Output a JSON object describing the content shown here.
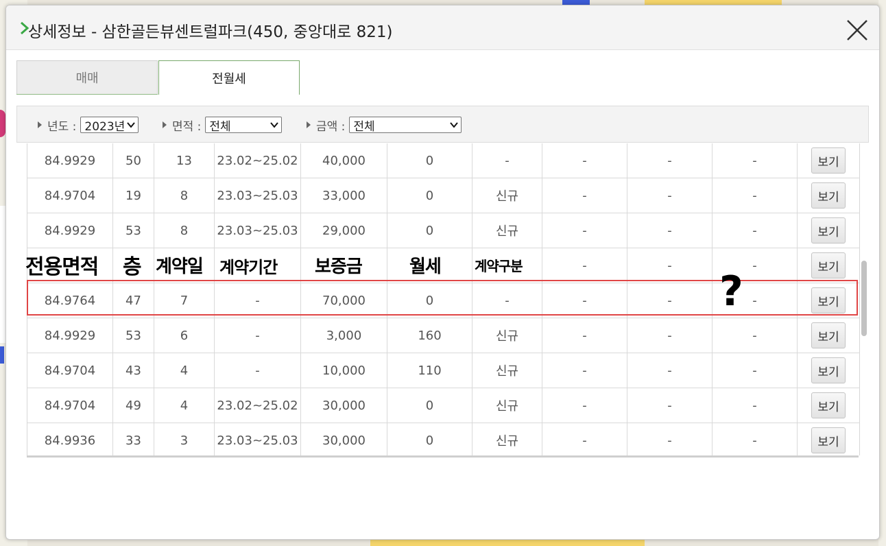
{
  "dialog": {
    "title": "상세정보 - 삼한골든뷰센트럴파크(450, 중앙대로 821)"
  },
  "tabs": [
    {
      "label": "매매",
      "active": false
    },
    {
      "label": "전월세",
      "active": true
    }
  ],
  "filters": {
    "year": {
      "label": "년도 :",
      "value": "2023년"
    },
    "area": {
      "label": "면적 :",
      "value": "전체"
    },
    "price": {
      "label": "금액 :",
      "value": "전체"
    }
  },
  "overlay_headers": [
    "전용면적",
    "층",
    "계약일",
    "계약기간",
    "보증금",
    "월세",
    "계약구분"
  ],
  "overlay_question": "?",
  "view_label": "보기",
  "rows": [
    {
      "area": "84.9929",
      "floor": "50",
      "day": "13",
      "period": "23.02~25.02",
      "deposit": "40,000",
      "rent": "0",
      "type": "-",
      "c1": "-",
      "c2": "-",
      "c3": "-"
    },
    {
      "area": "84.9704",
      "floor": "19",
      "day": "8",
      "period": "23.03~25.03",
      "deposit": "33,000",
      "rent": "0",
      "type": "신규",
      "c1": "-",
      "c2": "-",
      "c3": "-"
    },
    {
      "area": "84.9929",
      "floor": "53",
      "day": "8",
      "period": "23.03~25.03",
      "deposit": "29,000",
      "rent": "0",
      "type": "신규",
      "c1": "-",
      "c2": "-",
      "c3": "-"
    },
    {
      "area": "",
      "floor": "",
      "day": "",
      "period": "",
      "deposit": "",
      "rent": "",
      "type": "",
      "c1": "-",
      "c2": "-",
      "c3": "-"
    },
    {
      "area": "84.9764",
      "floor": "47",
      "day": "7",
      "period": "-",
      "deposit": "70,000",
      "rent": "0",
      "type": "-",
      "c1": "-",
      "c2": "-",
      "c3": "-"
    },
    {
      "area": "84.9929",
      "floor": "53",
      "day": "6",
      "period": "-",
      "deposit": "3,000",
      "rent": "160",
      "type": "신규",
      "c1": "-",
      "c2": "-",
      "c3": "-"
    },
    {
      "area": "84.9704",
      "floor": "43",
      "day": "4",
      "period": "-",
      "deposit": "10,000",
      "rent": "110",
      "type": "신규",
      "c1": "-",
      "c2": "-",
      "c3": "-"
    },
    {
      "area": "84.9704",
      "floor": "49",
      "day": "4",
      "period": "23.02~25.02",
      "deposit": "30,000",
      "rent": "0",
      "type": "신규",
      "c1": "-",
      "c2": "-",
      "c3": "-"
    },
    {
      "area": "84.9936",
      "floor": "33",
      "day": "3",
      "period": "23.03~25.03",
      "deposit": "30,000",
      "rent": "0",
      "type": "신규",
      "c1": "-",
      "c2": "-",
      "c3": "-"
    }
  ]
}
